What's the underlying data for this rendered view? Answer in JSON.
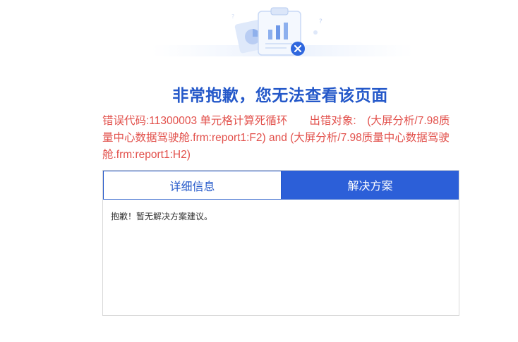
{
  "title": "非常抱歉，您无法查看该页面",
  "error_message": "错误代码:11300003 单元格计算死循环　　出错对象:　(大屏分析/7.98质量中心数据驾驶舱.frm:report1:F2) and (大屏分析/7.98质量中心数据驾驶舱.frm:report1:H2)",
  "tabs": [
    {
      "label": "详细信息",
      "active": false
    },
    {
      "label": "解决方案",
      "active": true
    }
  ],
  "content_text": "抱歉！暂无解决方案建议。",
  "colors": {
    "title": "#2458c9",
    "error": "#e2504b",
    "tab_active_bg": "#2c5fd8",
    "tab_border": "#2458c9"
  },
  "icons": {
    "illustration": "clipboard-report-illustration",
    "error_badge": "close-circle-icon"
  }
}
